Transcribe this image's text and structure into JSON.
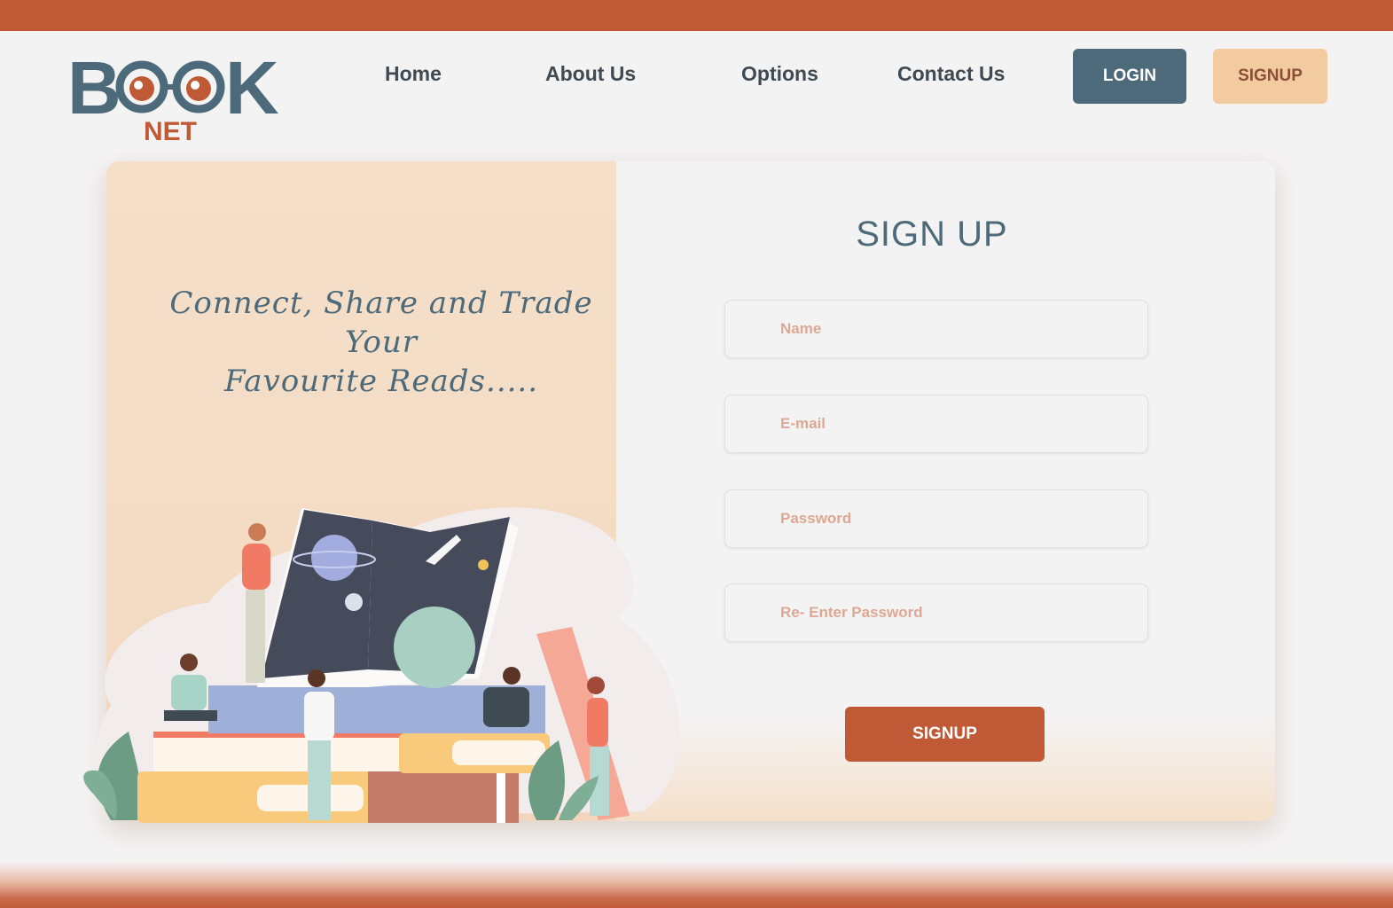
{
  "logo": {
    "book_text": "BOOK",
    "net_text": "NET"
  },
  "nav": {
    "home": "Home",
    "about": "About Us",
    "options": "Options",
    "contact": "Contact Us",
    "login": "LOGIN",
    "signup": "SIGNUP"
  },
  "hero": {
    "tagline_line1": "Connect, Share and Trade",
    "tagline_line2": "Your",
    "tagline_line3": "Favourite Reads....."
  },
  "form": {
    "title": "SIGN UP",
    "name_placeholder": "Name",
    "email_placeholder": "E-mail",
    "password_placeholder": "Password",
    "repassword_placeholder": "Re- Enter Password",
    "submit_label": "SIGNUP"
  },
  "colors": {
    "brand_orange": "#c05a36",
    "brand_slate": "#4d6a7a",
    "peach": "#f2cba0"
  }
}
